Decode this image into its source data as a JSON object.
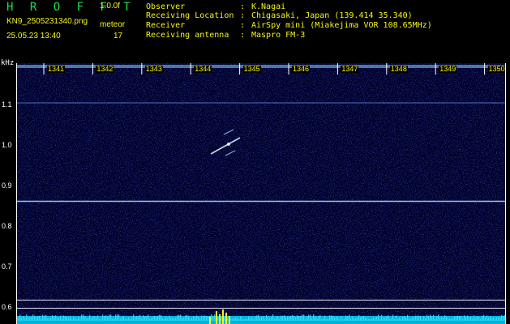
{
  "header": {
    "app_title": "H R O F F T",
    "version": "1.0.0f",
    "filename": "KN9_2505231340.png",
    "meteor_label": "meteor",
    "datetime": "25.05.23 13:40",
    "meteor_count": "17"
  },
  "info": [
    {
      "key": "Observer",
      "sep": ":",
      "value": "K.Nagai"
    },
    {
      "key": "Receiving Location",
      "sep": ":",
      "value": "Chigasaki, Japan (139.414 35.340)"
    },
    {
      "key": "Receiver",
      "sep": ":",
      "value": "AirSpy mini (Miakejima VOR 108.65MHz)"
    },
    {
      "key": "Receiving antenna",
      "sep": ":",
      "value": "Maspro FM-3"
    }
  ],
  "plot": {
    "y_unit": "kHz",
    "y_ticks": [
      "1.1",
      "1.0",
      "0.9",
      "0.8",
      "0.7",
      "0.6"
    ],
    "time_ticks": [
      "1341",
      "1342",
      "1343",
      "1344",
      "1345",
      "1346",
      "1347",
      "1348",
      "1349",
      "1350"
    ],
    "colors": {
      "background": "#000028",
      "noise": "#1a2cff",
      "carrier": "#9fd0ff",
      "axis": "#ffffff",
      "tick_label": "#ffff00"
    }
  }
}
